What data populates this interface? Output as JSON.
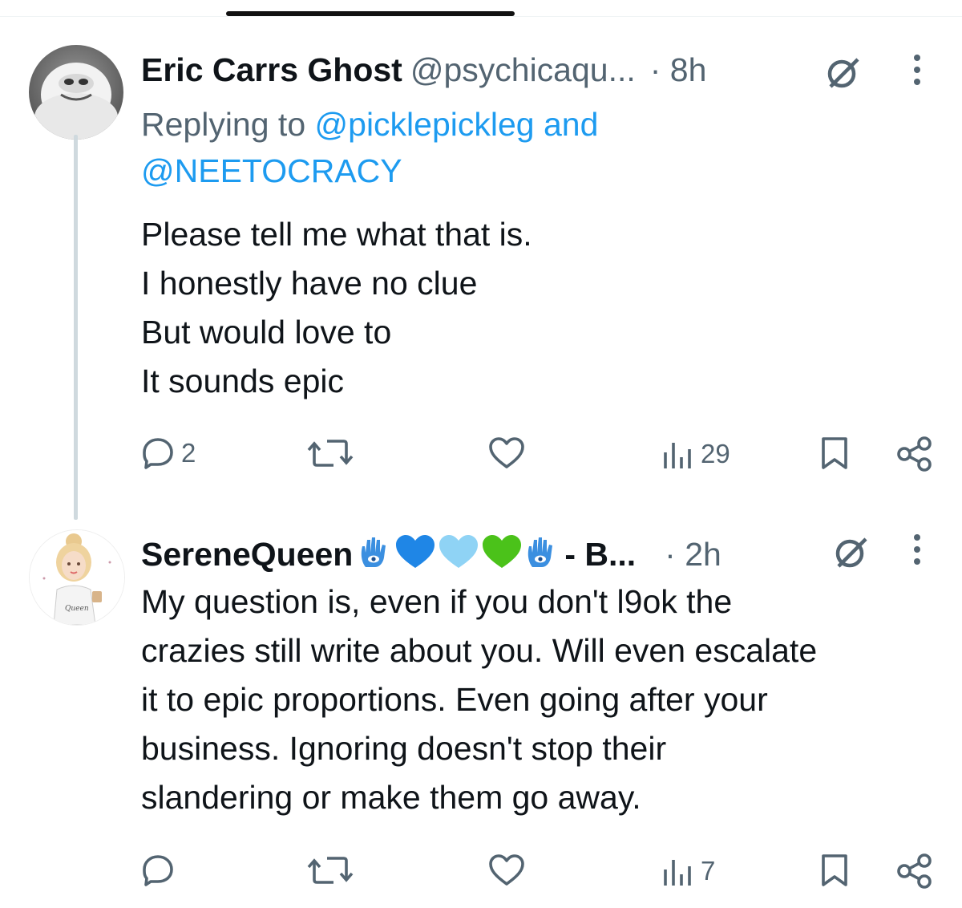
{
  "tweets": [
    {
      "author": {
        "name": "Eric Carrs Ghost",
        "handle": "@psychicaqu...",
        "avatar": "yeti-avatar"
      },
      "time": "· 8h",
      "reply_prefix": "Replying to ",
      "reply_mention1": "@picklepickleg",
      "reply_and": " and",
      "reply_mention2": "@NEETOCRACY",
      "text": "Please tell me what that is.\nI honestly have no clue\nBut would love to\nIt sounds epic",
      "stats": {
        "replies": "2",
        "reposts": "",
        "likes": "",
        "views": "29"
      }
    },
    {
      "author": {
        "name": "SereneQueen",
        "name_suffix": "- B...",
        "avatar": "queen-avatar",
        "emojis": [
          "hamsa-icon",
          "blue-heart-icon",
          "light-blue-heart-icon",
          "green-heart-icon",
          "hamsa-icon"
        ]
      },
      "time": "· 2h",
      "text": "My question is, even if you don't l9ok the\ncrazies still write about you.  Will even escalate\nit to epic proportions.  Even going after your\nbusiness.  Ignoring doesn't stop their\nslandering or make them go away.",
      "stats": {
        "replies": "",
        "reposts": "",
        "likes": "",
        "views": "7"
      }
    }
  ],
  "colors": {
    "text": "#0f1419",
    "secondary": "#536471",
    "link": "#1d9bf0",
    "thread_line": "#cfd9de"
  }
}
